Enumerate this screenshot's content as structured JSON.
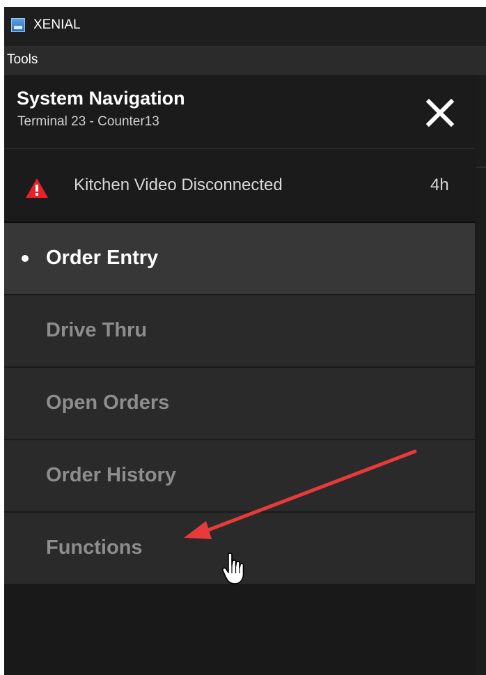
{
  "window": {
    "app_title": "XENIAL",
    "icon": "xenial-app-icon"
  },
  "menubar": {
    "items": [
      {
        "label": "Tools"
      }
    ]
  },
  "panel": {
    "title": "System Navigation",
    "subtitle": "Terminal 23 - Counter13",
    "close_icon": "close-icon"
  },
  "alert": {
    "icon": "warning-icon",
    "message": "Kitchen Video Disconnected",
    "time": "4h",
    "colors": {
      "icon_red": "#e8202a"
    }
  },
  "nav": {
    "items": [
      {
        "label": "Order Entry",
        "active": true
      },
      {
        "label": "Drive Thru",
        "active": false
      },
      {
        "label": "Open Orders",
        "active": false
      },
      {
        "label": "Order History",
        "active": false
      },
      {
        "label": "Functions",
        "active": false
      }
    ]
  },
  "annotation": {
    "arrow_color": "#e83a3a",
    "cursor_icon": "hand-pointer-icon"
  }
}
